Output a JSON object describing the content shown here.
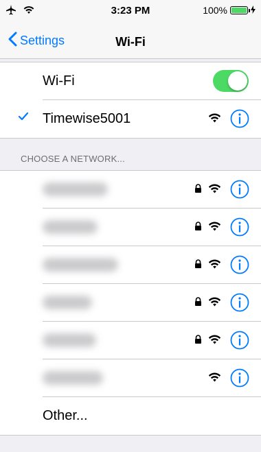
{
  "status_bar": {
    "time": "3:23 PM",
    "battery": "100%"
  },
  "nav": {
    "back_label": "Settings",
    "title": "Wi-Fi"
  },
  "wifi_toggle": {
    "label": "Wi-Fi",
    "on": true,
    "on_color": "#4cd964"
  },
  "connected": {
    "name": "Timewise5001"
  },
  "section_header": "CHOOSE A NETWORK...",
  "networks": [
    {
      "name": "",
      "locked": true
    },
    {
      "name": "",
      "locked": true
    },
    {
      "name": "",
      "locked": true
    },
    {
      "name": "",
      "locked": true
    },
    {
      "name": "",
      "locked": true
    },
    {
      "name": "",
      "locked": false
    }
  ],
  "other_label": "Other...",
  "colors": {
    "accent": "#007aff",
    "background": "#efeff4"
  }
}
